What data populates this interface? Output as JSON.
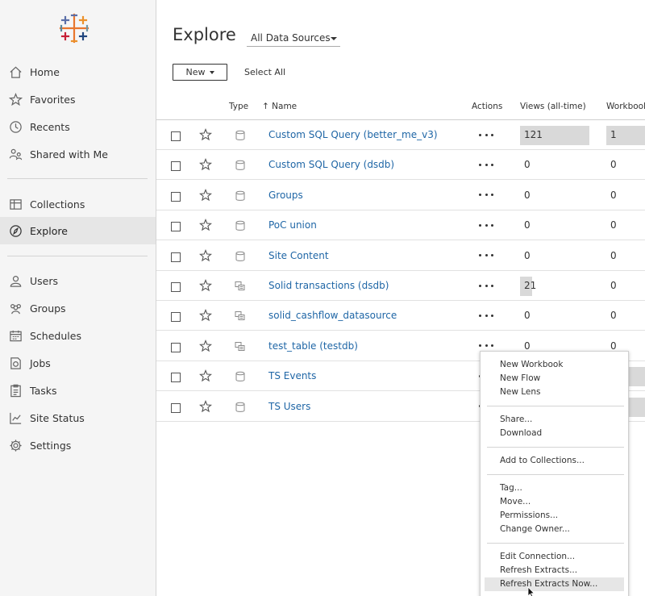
{
  "sidebar": {
    "items": [
      {
        "label": "Home",
        "icon": "home-icon"
      },
      {
        "label": "Favorites",
        "icon": "star-icon"
      },
      {
        "label": "Recents",
        "icon": "clock-icon"
      },
      {
        "label": "Shared with Me",
        "icon": "shared-icon"
      },
      {
        "label": "Collections",
        "icon": "collections-icon"
      },
      {
        "label": "Explore",
        "icon": "compass-icon",
        "active": true
      },
      {
        "label": "Users",
        "icon": "user-icon"
      },
      {
        "label": "Groups",
        "icon": "group-icon"
      },
      {
        "label": "Schedules",
        "icon": "calendar-icon"
      },
      {
        "label": "Jobs",
        "icon": "jobs-icon"
      },
      {
        "label": "Tasks",
        "icon": "tasks-icon"
      },
      {
        "label": "Site Status",
        "icon": "site-status-icon"
      },
      {
        "label": "Settings",
        "icon": "gear-icon"
      }
    ]
  },
  "header": {
    "title": "Explore",
    "datasource_filter": "All Data Sources"
  },
  "toolbar": {
    "new_label": "New",
    "select_all_label": "Select All"
  },
  "table": {
    "columns": [
      "Type",
      "Name",
      "Actions",
      "Views (all-time)",
      "Workbook"
    ],
    "sort_indicator": "↑",
    "rows": [
      {
        "name": "Custom SQL Query (better_me_v3)",
        "type": "database",
        "views": "121",
        "workbooks": "1",
        "views_fraction": 1.0,
        "wb_bar": true
      },
      {
        "name": "Custom SQL Query (dsdb)",
        "type": "database",
        "views": "0",
        "workbooks": "0",
        "views_fraction": 0,
        "wb_bar": false
      },
      {
        "name": "Groups",
        "type": "database",
        "views": "0",
        "workbooks": "0",
        "views_fraction": 0,
        "wb_bar": false
      },
      {
        "name": "PoC union",
        "type": "database",
        "views": "0",
        "workbooks": "0",
        "views_fraction": 0,
        "wb_bar": false
      },
      {
        "name": "Site Content",
        "type": "database",
        "views": "0",
        "workbooks": "0",
        "views_fraction": 0,
        "wb_bar": false
      },
      {
        "name": "Solid transactions (dsdb)",
        "type": "extract",
        "views": "21",
        "workbooks": "0",
        "views_fraction": 0.17,
        "wb_bar": false
      },
      {
        "name": "solid_cashflow_datasource",
        "type": "extract",
        "views": "0",
        "workbooks": "0",
        "views_fraction": 0,
        "wb_bar": false
      },
      {
        "name": "test_table (testdb)",
        "type": "extract",
        "views": "0",
        "workbooks": "0",
        "views_fraction": 0,
        "wb_bar": false
      },
      {
        "name": "TS Events",
        "type": "database",
        "views": "",
        "workbooks": "",
        "views_fraction": 0,
        "wb_bar": true
      },
      {
        "name": "TS Users",
        "type": "database",
        "views": "",
        "workbooks": "",
        "views_fraction": 0,
        "wb_bar": true
      }
    ]
  },
  "context_menu": {
    "groups": [
      [
        "New Workbook",
        "New Flow",
        "New Lens"
      ],
      [
        "Share...",
        "Download"
      ],
      [
        "Add to Collections..."
      ],
      [
        "Tag...",
        "Move...",
        "Permissions...",
        "Change Owner..."
      ],
      [
        "Edit Connection...",
        "Refresh Extracts...",
        "Refresh Extracts Now..."
      ]
    ],
    "highlighted": "Refresh Extracts Now..."
  },
  "colors": {
    "link": "#1f66a6",
    "sidebar_bg": "#f5f5f5",
    "bar": "#d9d9d9"
  }
}
